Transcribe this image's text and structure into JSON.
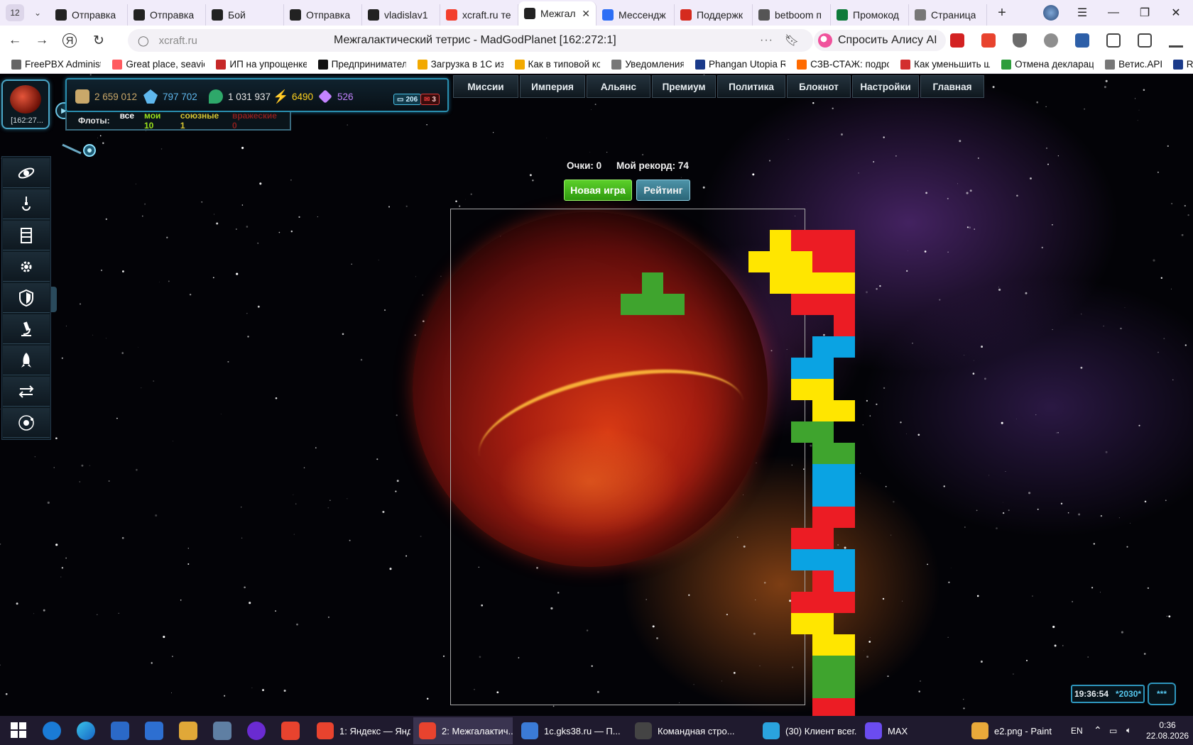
{
  "browser": {
    "tab_count": "12",
    "tabs": [
      {
        "title": "Отправка",
        "icon": "xcraft-icon",
        "color": "#222222",
        "active": false
      },
      {
        "title": "Отправка",
        "icon": "xcraft-icon",
        "color": "#222222",
        "active": false
      },
      {
        "title": "Бой",
        "icon": "xcraft-icon",
        "color": "#222222",
        "active": false
      },
      {
        "title": "Отправка",
        "icon": "xcraft-icon",
        "color": "#222222",
        "active": false
      },
      {
        "title": "vladislav1",
        "icon": "xcraft-icon",
        "color": "#222222",
        "active": false
      },
      {
        "title": "xcraft.ru те",
        "icon": "yandex-icon",
        "color": "#f33e2c",
        "active": false
      },
      {
        "title": "Межгал",
        "icon": "xcraft-icon",
        "color": "#222222",
        "active": true
      },
      {
        "title": "Мессендж",
        "icon": "messenger-icon",
        "color": "#2d6ef5",
        "active": false
      },
      {
        "title": "Поддержк",
        "icon": "flag-ru-icon",
        "color": "#d52b1e",
        "active": false
      },
      {
        "title": "betboom п",
        "icon": "betboom-icon",
        "color": "#555555",
        "active": false
      },
      {
        "title": "Промокод",
        "icon": "promo-icon",
        "color": "#0e7a3a",
        "active": false
      },
      {
        "title": "Страница",
        "icon": "page-icon",
        "color": "#777777",
        "active": false
      }
    ],
    "url": "xcraft.ru",
    "page_title": "Межгалактический тетрис - MadGodPlanet [162:272:1]",
    "alice_label": "Спросить Алису AI",
    "bookmarks": [
      {
        "label": "FreePBX Administ",
        "color": "#666666"
      },
      {
        "label": "Great place, seavie",
        "color": "#ff5a5f"
      },
      {
        "label": "ИП на упрощенке",
        "color": "#c62828"
      },
      {
        "label": "Предпринимател",
        "color": "#111111"
      },
      {
        "label": "Загрузка в 1С из",
        "color": "#f2a900"
      },
      {
        "label": "Как в типовой ко",
        "color": "#f2a900"
      },
      {
        "label": "Уведомления",
        "color": "#777777"
      },
      {
        "label": "Phangan Utopia R",
        "color": "#1a3a8a"
      },
      {
        "label": "СЗВ-СТАЖ: подро",
        "color": "#ff6a00"
      },
      {
        "label": "Как уменьшить ш",
        "color": "#d32f2f"
      },
      {
        "label": "Отмена деклараци",
        "color": "#2e9d3c"
      },
      {
        "label": "Ветис.API",
        "color": "#777777"
      },
      {
        "label": "R",
        "color": "#1a3a8a"
      }
    ]
  },
  "game": {
    "avatar_coords": "[162:27...",
    "resources": [
      {
        "name": "metal",
        "value": "2 659 012",
        "color": "#c9a86a",
        "icon": "metal-icon"
      },
      {
        "name": "crystal",
        "value": "797 702",
        "color": "#5fb8ee",
        "icon": "crystal-icon"
      },
      {
        "name": "deuterium",
        "value": "1 031 937",
        "color": "#e6e6e6",
        "icon": "deuterium-icon"
      },
      {
        "name": "energy",
        "value": "6490",
        "color": "#ffd21e",
        "icon": "energy-icon"
      },
      {
        "name": "premium",
        "value": "526",
        "color": "#c383ff",
        "icon": "premium-icon"
      }
    ],
    "chat_count": "206",
    "mail_count": "3",
    "fleets_label": "Флоты:",
    "fleets": [
      {
        "label": "все",
        "color": "#ffffff"
      },
      {
        "label": "мои 10",
        "color": "#9be31c"
      },
      {
        "label": "союзные 1",
        "color": "#d8c832"
      },
      {
        "label": "враж­еские 0",
        "color": "#8a1e1e"
      }
    ],
    "menu": [
      "Миссии",
      "Империя",
      "Альянс",
      "Премиум",
      "Политика",
      "Блокнот",
      "Настройки",
      "Главная"
    ],
    "sidebar": [
      "galaxy-icon",
      "crane-icon",
      "buildings-icon",
      "gear-icon",
      "shield-icon",
      "microscope-icon",
      "rocket-icon",
      "exchange-icon",
      "orbit-icon"
    ],
    "score_label": "Очки: 0",
    "record_label": "Мой рекорд: 74",
    "new_game_label": "Новая игра",
    "rating_label": "Рейтинг",
    "clock_time": "19:36:54",
    "clock_server": "*2030*",
    "chat_button": "***",
    "tetris": {
      "falling_piece": [
        [
          9,
          3
        ],
        [
          8,
          4
        ],
        [
          9,
          4
        ],
        [
          10,
          4
        ]
      ],
      "falling_color": "g",
      "stack": [
        [
          15,
          1,
          "y"
        ],
        [
          16,
          1,
          "r"
        ],
        [
          17,
          1,
          "r"
        ],
        [
          18,
          1,
          "r"
        ],
        [
          14,
          2,
          "y"
        ],
        [
          15,
          2,
          "y"
        ],
        [
          16,
          2,
          "y"
        ],
        [
          17,
          2,
          "r"
        ],
        [
          18,
          2,
          "r"
        ],
        [
          15,
          3,
          "y"
        ],
        [
          16,
          3,
          "y"
        ],
        [
          17,
          3,
          "y"
        ],
        [
          18,
          3,
          "y"
        ],
        [
          16,
          4,
          "r"
        ],
        [
          17,
          4,
          "r"
        ],
        [
          18,
          4,
          "r"
        ],
        [
          18,
          5,
          "r"
        ],
        [
          17,
          6,
          "b"
        ],
        [
          18,
          6,
          "b"
        ],
        [
          16,
          7,
          "b"
        ],
        [
          17,
          7,
          "b"
        ],
        [
          16,
          8,
          "y"
        ],
        [
          17,
          8,
          "y"
        ],
        [
          17,
          9,
          "y"
        ],
        [
          18,
          9,
          "y"
        ],
        [
          16,
          10,
          "g"
        ],
        [
          17,
          10,
          "g"
        ],
        [
          17,
          11,
          "g"
        ],
        [
          18,
          11,
          "g"
        ],
        [
          17,
          12,
          "b"
        ],
        [
          18,
          12,
          "b"
        ],
        [
          17,
          13,
          "b"
        ],
        [
          18,
          13,
          "b"
        ],
        [
          17,
          14,
          "r"
        ],
        [
          18,
          14,
          "r"
        ],
        [
          16,
          15,
          "r"
        ],
        [
          17,
          15,
          "r"
        ],
        [
          16,
          16,
          "b"
        ],
        [
          17,
          16,
          "b"
        ],
        [
          18,
          16,
          "b"
        ],
        [
          17,
          17,
          "r"
        ],
        [
          18,
          17,
          "b"
        ],
        [
          16,
          18,
          "r"
        ],
        [
          17,
          18,
          "r"
        ],
        [
          18,
          18,
          "r"
        ],
        [
          16,
          19,
          "y"
        ],
        [
          17,
          19,
          "y"
        ],
        [
          17,
          20,
          "y"
        ],
        [
          18,
          20,
          "y"
        ],
        [
          17,
          21,
          "g"
        ],
        [
          18,
          21,
          "g"
        ],
        [
          17,
          22,
          "g"
        ],
        [
          18,
          22,
          "g"
        ],
        [
          17,
          23,
          "r"
        ],
        [
          18,
          23,
          "r"
        ]
      ]
    }
  },
  "taskbar": {
    "apps": [
      {
        "label": "1: Яндекс — Янд...",
        "icon": "yandex-browser-icon",
        "color": "#e8432e",
        "active": false
      },
      {
        "label": "2: Межгалактич...",
        "icon": "yandex-browser-icon",
        "color": "#e8432e",
        "active": true
      },
      {
        "label": "1c.gks38.ru — П...",
        "icon": "remote-desktop-icon",
        "color": "#3b7bd6",
        "active": false
      },
      {
        "label": "Командная стро...",
        "icon": "terminal-icon",
        "color": "#444444",
        "active": false
      },
      {
        "label": "(30) Клиент всег...",
        "icon": "telegram-icon",
        "color": "#2aa3de",
        "active": false
      },
      {
        "label": "MAX",
        "icon": "max-icon",
        "color": "#6b4cf0",
        "active": false
      },
      {
        "label": "e2.png - Paint",
        "icon": "paint-icon",
        "color": "#e9a93a",
        "active": false
      }
    ],
    "lang": "EN",
    "time": "0:36",
    "date": "22.08.2026"
  }
}
